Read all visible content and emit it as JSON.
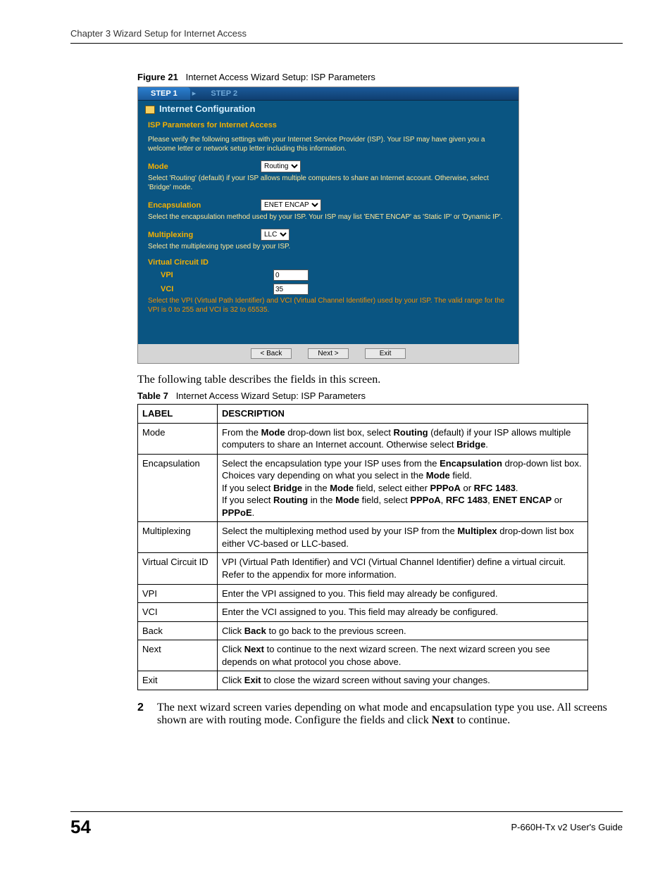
{
  "header": {
    "chapter": "Chapter 3 Wizard Setup for Internet Access"
  },
  "figure": {
    "label": "Figure 21",
    "title": "Internet Access Wizard Setup: ISP Parameters"
  },
  "wizard": {
    "steps": {
      "s1": "STEP 1",
      "s2": "STEP 2"
    },
    "title": "Internet Configuration",
    "section": "ISP Parameters for Internet Access",
    "intro": "Please verify the following settings with your Internet Service Provider (ISP). Your ISP may have given you a welcome letter or network setup letter including this information.",
    "mode": {
      "label": "Mode",
      "value": "Routing",
      "help": "Select 'Routing' (default) if your ISP allows multiple computers to share an Internet account. Otherwise, select 'Bridge' mode."
    },
    "encap": {
      "label": "Encapsulation",
      "value": "ENET ENCAP",
      "help": "Select the encapsulation method used by your ISP. Your ISP may list 'ENET ENCAP' as 'Static IP' or 'Dynamic IP'."
    },
    "mux": {
      "label": "Multiplexing",
      "value": "LLC",
      "help": "Select the multiplexing type used by your ISP."
    },
    "vcid": {
      "label": "Virtual Circuit ID",
      "vpi_label": "VPI",
      "vpi_value": "0",
      "vci_label": "VCI",
      "vci_value": "35",
      "help": "Select the VPI (Virtual Path Identifier) and VCI (Virtual Channel Identifier) used by your ISP. The valid range for the VPI is 0 to 255 and VCI is 32 to 65535."
    },
    "buttons": {
      "back": "< Back",
      "next": "Next >",
      "exit": "Exit"
    }
  },
  "afterFigureText": "The following table describes the fields in this screen.",
  "table": {
    "label": "Table 7",
    "title": "Internet Access Wizard Setup: ISP Parameters",
    "head": {
      "c1": "LABEL",
      "c2": "DESCRIPTION"
    }
  },
  "step2": {
    "num": "2",
    "text_before": "The next wizard screen varies depending on what mode and encapsulation type you use. All screens shown are with routing mode. Configure the fields and click ",
    "bold": "Next",
    "text_after": " to continue."
  },
  "footer": {
    "page": "54",
    "guide": "P-660H-Tx v2 User's Guide"
  }
}
